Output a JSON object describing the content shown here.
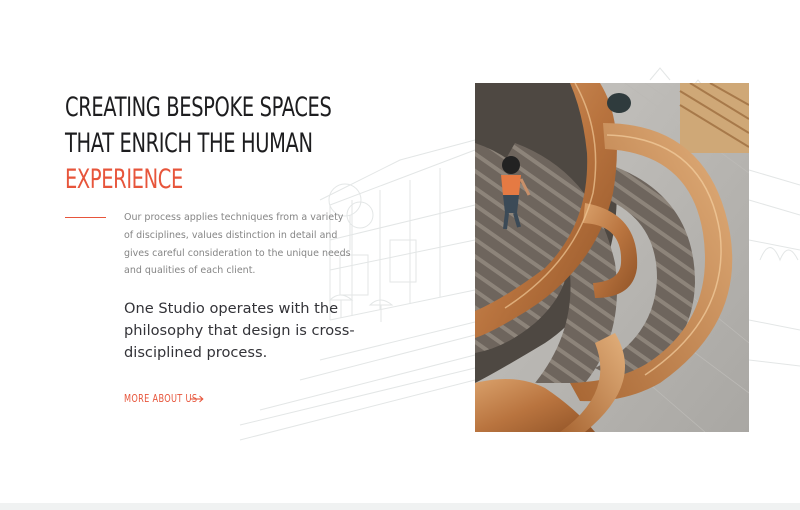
{
  "headline": {
    "line1": "CREATING BESPOKE SPACES",
    "line2": "THAT ENRICH THE HUMAN",
    "line3": "EXPERIENCE"
  },
  "description": "Our process applies techniques from a variety of disciplines, values distinction in detail and gives careful consideration to the unique needs and qualities of each client.",
  "philosophy": "One Studio operates with the philosophy that design is cross-disciplined process.",
  "more_link": {
    "label": "MORE ABOUT US",
    "icon": "arrow-right-icon"
  },
  "image": {
    "subject": "spiral-wooden-staircase-photo"
  },
  "colors": {
    "accent": "#e7553b",
    "heading": "#1d1d1f",
    "body": "#858585",
    "philosophy": "#333338",
    "footer_band": "#f0f2f2",
    "sketch_lines": "#e3e6e6"
  }
}
